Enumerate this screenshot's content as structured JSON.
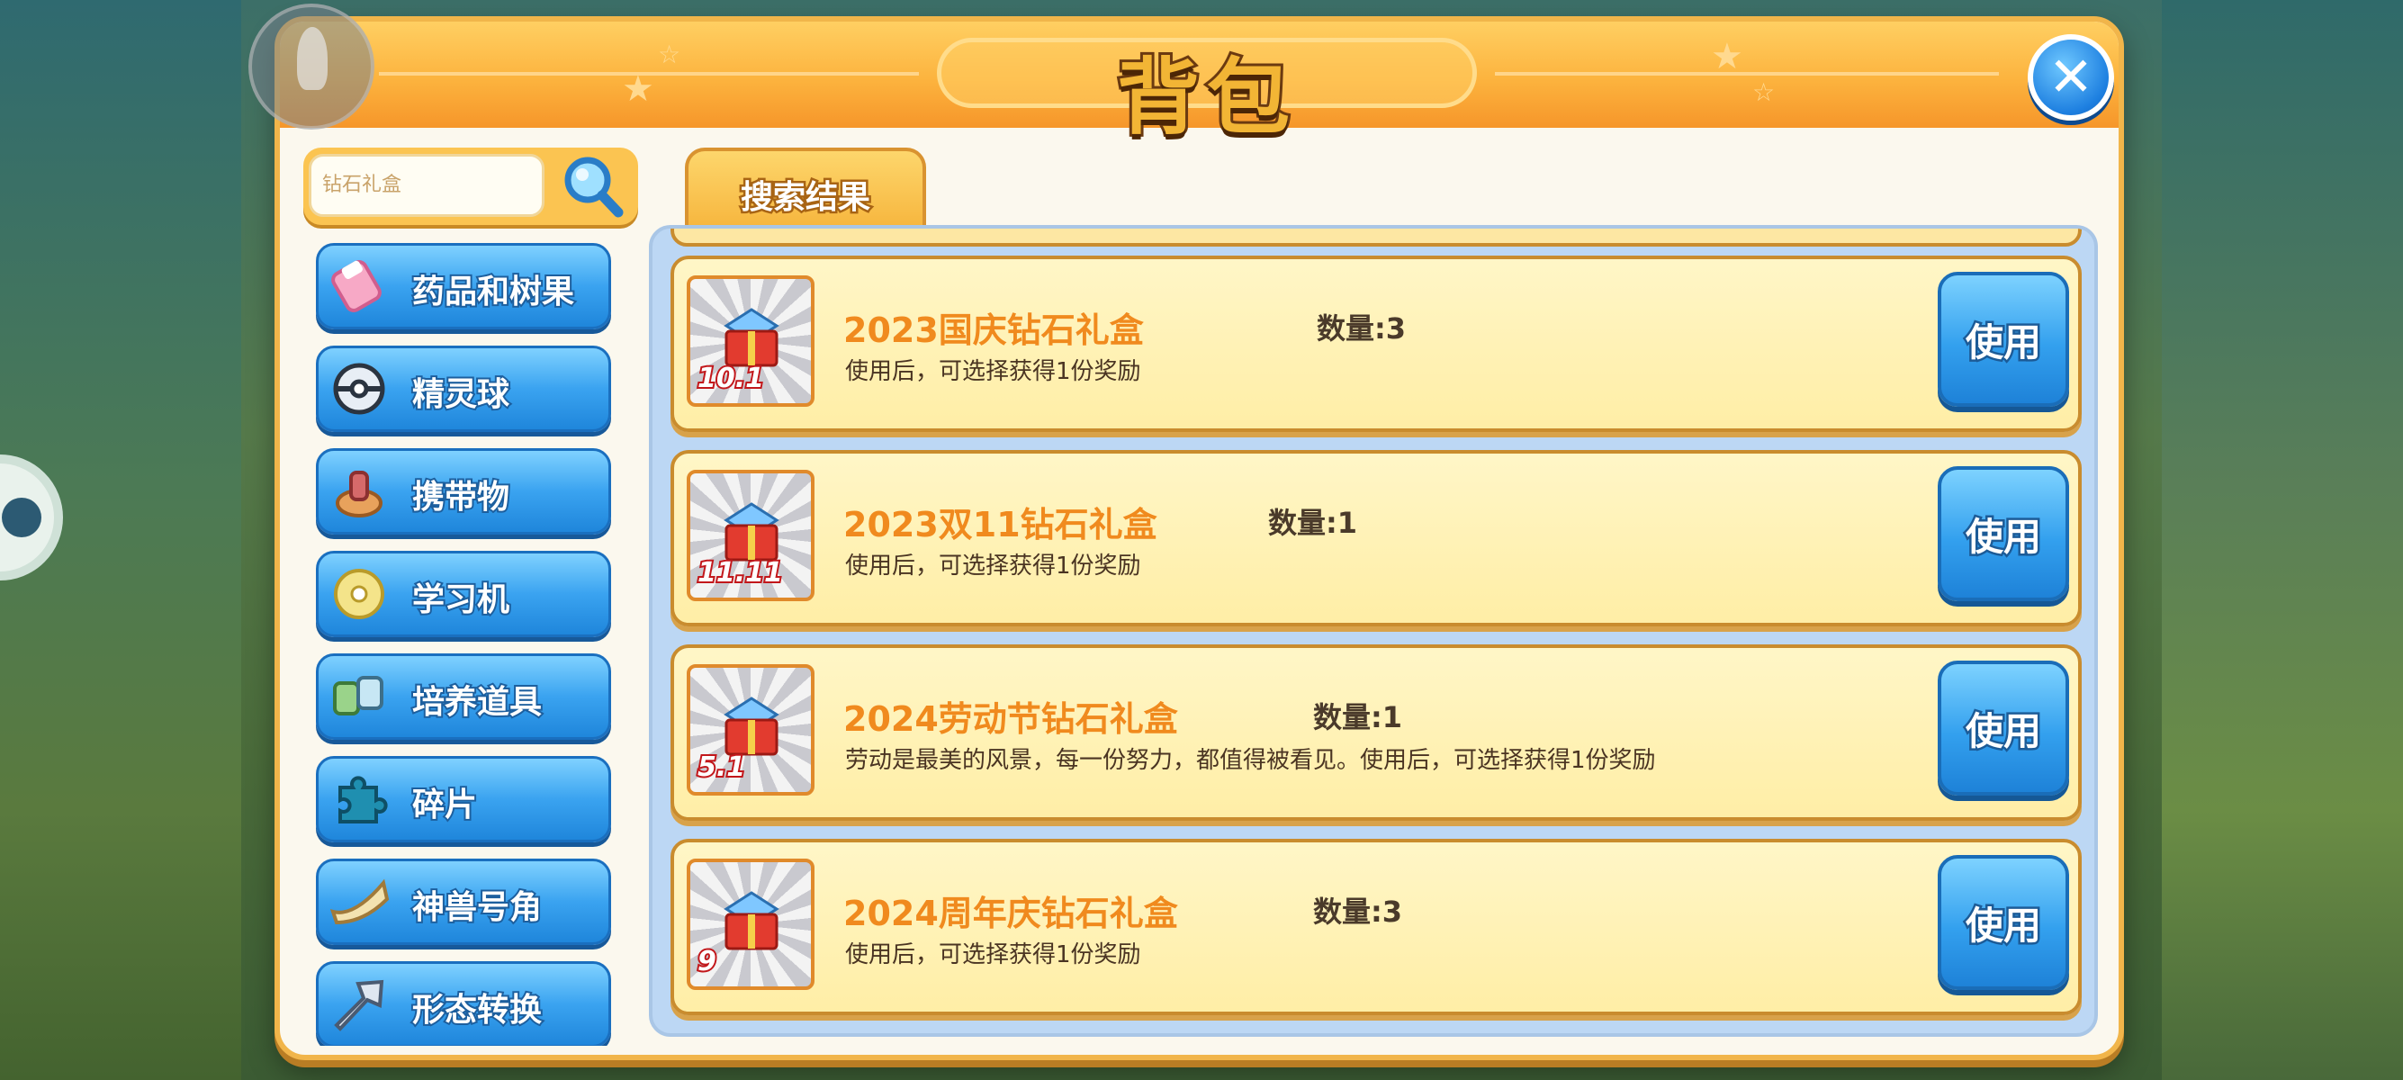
{
  "window": {
    "title": "背包",
    "close_icon": "close-icon"
  },
  "search": {
    "placeholder": "钻石礼盒",
    "button_icon": "magnifier-icon"
  },
  "sidebar": {
    "items": [
      {
        "label": "药品和树果",
        "icon": "potion-icon"
      },
      {
        "label": "精灵球",
        "icon": "pokeball-icon"
      },
      {
        "label": "携带物",
        "icon": "held-item-icon"
      },
      {
        "label": "学习机",
        "icon": "disc-icon"
      },
      {
        "label": "培养道具",
        "icon": "training-items-icon"
      },
      {
        "label": "碎片",
        "icon": "puzzle-piece-icon"
      },
      {
        "label": "神兽号角",
        "icon": "horn-icon"
      },
      {
        "label": "形态转换",
        "icon": "transform-icon"
      }
    ]
  },
  "tabs": [
    {
      "label": "搜索结果",
      "active": true
    }
  ],
  "items": [
    {
      "name": "2023国庆钻石礼盒",
      "quantity": "数量:3",
      "description": "使用后，可选择获得1份奖励",
      "badge": "10.1",
      "button": "使用"
    },
    {
      "name": "2023双11钻石礼盒",
      "quantity": "数量:1",
      "description": "使用后，可选择获得1份奖励",
      "badge": "11.11",
      "button": "使用"
    },
    {
      "name": "2024劳动节钻石礼盒",
      "quantity": "数量:1",
      "description": "劳动是最美的风景，每一份努力，都值得被看见。使用后，可选择获得1份奖励",
      "badge": "5.1",
      "button": "使用"
    },
    {
      "name": "2024周年庆钻石礼盒",
      "quantity": "数量:3",
      "description": "使用后，可选择获得1份奖励",
      "badge": "9",
      "button": "使用"
    }
  ],
  "colors": {
    "title_bar": "#fcb33e",
    "button_blue": "#33a0ee",
    "item_name": "#f08a1e",
    "card_bg": "#fff3b8"
  }
}
